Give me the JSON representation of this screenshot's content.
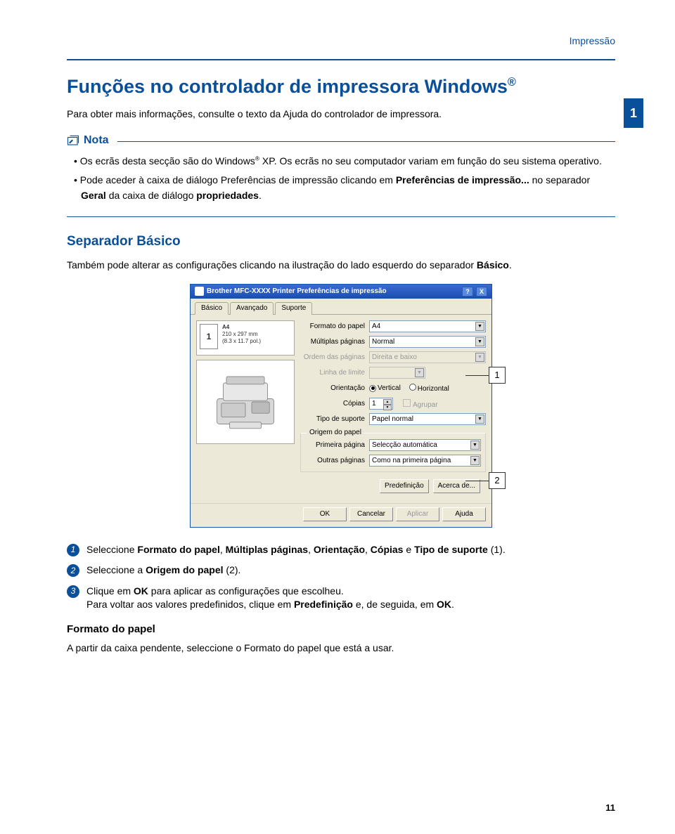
{
  "section_label": "Impressão",
  "title_main": "Funções no controlador de impressora Windows",
  "reg_mark": "®",
  "intro_text": "Para obter mais informações, consulte o texto da Ajuda do controlador de impressora.",
  "side_tab": "1",
  "nota": {
    "heading": "Nota",
    "bullet1_a": "Os ecrãs desta secção são do Windows",
    "bullet1_b": " XP. Os ecrãs no seu computador variam em função do seu sistema operativo.",
    "bullet2_a": "Pode aceder à caixa de diálogo Preferências de impressão clicando em ",
    "bullet2_b": "Preferências de impressão...",
    "bullet2_c": " no separador ",
    "bullet2_d": "Geral",
    "bullet2_e": " da caixa de diálogo ",
    "bullet2_f": "propriedades",
    "bullet2_g": "."
  },
  "sep_heading": "Separador Básico",
  "sep_para_a": "Também pode alterar as configurações clicando na ilustração do lado esquerdo do separador ",
  "sep_para_b": "Básico",
  "sep_para_c": ".",
  "dialog": {
    "title": "Brother MFC-XXXX Printer Preferências de impressão",
    "help_btn": "?",
    "close_btn": "X",
    "tabs": {
      "basico": "Básico",
      "avancado": "Avançado",
      "suporte": "Suporte"
    },
    "paper": {
      "name": "A4",
      "size1": "210 x 297 mm",
      "size2": "(8.3 x 11.7 pol.)",
      "badge": "1"
    },
    "labels": {
      "formato": "Formato do papel",
      "multiplas": "Múltiplas páginas",
      "ordem": "Ordem das páginas",
      "linha": "Linha de limite",
      "orient": "Orientação",
      "copias": "Cópias",
      "tipo": "Tipo de suporte",
      "origem_legend": "Origem do papel",
      "primeira": "Primeira página",
      "outras": "Outras páginas"
    },
    "values": {
      "formato": "A4",
      "multiplas": "Normal",
      "ordem": "Direita e baixo",
      "linha": "",
      "vertical": "Vertical",
      "horizontal": "Horizontal",
      "copias": "1",
      "agrupar": "Agrupar",
      "tipo": "Papel normal",
      "primeira": "Selecção automática",
      "outras": "Como na primeira página"
    },
    "buttons": {
      "predef": "Predefinição",
      "acerca": "Acerca de...",
      "ok": "OK",
      "cancelar": "Cancelar",
      "aplicar": "Aplicar",
      "ajuda": "Ajuda"
    }
  },
  "callouts": {
    "c1": "1",
    "c2": "2"
  },
  "steps": {
    "s1_a": "Seleccione ",
    "s1_b": "Formato do papel",
    "s1_c": ", ",
    "s1_d": "Múltiplas páginas",
    "s1_e": ", ",
    "s1_f": "Orientação",
    "s1_g": ", ",
    "s1_h": "Cópias",
    "s1_i": " e ",
    "s1_j": "Tipo de suporte",
    "s1_k": " (1).",
    "s2_a": "Seleccione a ",
    "s2_b": "Origem do papel",
    "s2_c": " (2).",
    "s3_a": "Clique em ",
    "s3_b": "OK",
    "s3_c": " para aplicar as configurações que escolheu.",
    "s3_d": "Para voltar aos valores predefinidos, clique em ",
    "s3_e": "Predefinição",
    "s3_f": " e, de seguida, em ",
    "s3_g": "OK",
    "s3_h": "."
  },
  "h3_formato": "Formato do papel",
  "formato_para": "A partir da caixa pendente, seleccione o Formato do papel que está a usar.",
  "page_number": "11"
}
